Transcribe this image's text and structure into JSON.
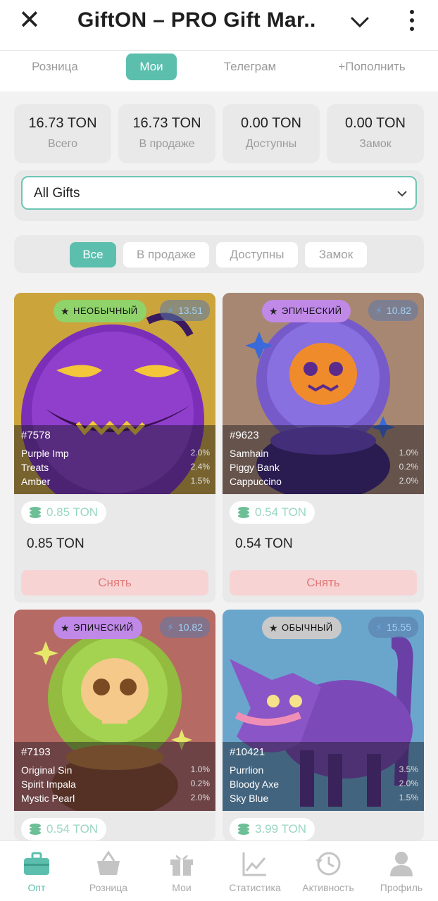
{
  "header": {
    "title": "GiftON – PRO Gift Mar..."
  },
  "tabs": [
    {
      "label": "Розница",
      "active": false
    },
    {
      "label": "Мои",
      "active": true
    },
    {
      "label": "Телеграм",
      "active": false
    },
    {
      "label": "+Пополнить",
      "active": false
    }
  ],
  "stats": [
    {
      "value": "16.73 TON",
      "label": "Всего"
    },
    {
      "value": "16.73 TON",
      "label": "В продаже"
    },
    {
      "value": "0.00 TON",
      "label": "Доступны"
    },
    {
      "value": "0.00 TON",
      "label": "Замок"
    }
  ],
  "select": {
    "value": "All Gifts"
  },
  "filters": [
    {
      "label": "Все",
      "active": true
    },
    {
      "label": "В продаже",
      "active": false
    },
    {
      "label": "Доступны",
      "active": false
    },
    {
      "label": "Замок",
      "active": false
    }
  ],
  "gifts": [
    {
      "rarity": "НЕОБЫЧНЫЙ",
      "rarity_color": "#8fd36a",
      "score": "13.51",
      "number": "#7578",
      "attrs": [
        {
          "name": "Purple Imp",
          "pct": "2.0%"
        },
        {
          "name": "Treats",
          "pct": "2.4%"
        },
        {
          "name": "Amber",
          "pct": "1.5%"
        }
      ],
      "price_badge": "0.85 TON",
      "price": "0.85 TON",
      "action": "Снять",
      "bg": "#caa23a"
    },
    {
      "rarity": "ЭПИЧЕСКИЙ",
      "rarity_color": "#c089e8",
      "score": "10.82",
      "number": "#9623",
      "attrs": [
        {
          "name": "Samhain",
          "pct": "1.0%"
        },
        {
          "name": "Piggy Bank",
          "pct": "0.2%"
        },
        {
          "name": "Cappuccino",
          "pct": "2.0%"
        }
      ],
      "price_badge": "0.54 TON",
      "price": "0.54 TON",
      "action": "Снять",
      "bg": "#a88772"
    },
    {
      "rarity": "ЭПИЧЕСКИЙ",
      "rarity_color": "#c089e8",
      "score": "10.82",
      "number": "#7193",
      "attrs": [
        {
          "name": "Original Sin",
          "pct": "1.0%"
        },
        {
          "name": "Spirit Impala",
          "pct": "0.2%"
        },
        {
          "name": "Mystic Pearl",
          "pct": "2.0%"
        }
      ],
      "price_badge": "0.54 TON",
      "bg": "#b66a64"
    },
    {
      "rarity": "ОБЫЧНЫЙ",
      "rarity_color": "#c9c9c9",
      "score": "15.55",
      "number": "#10421",
      "attrs": [
        {
          "name": "Purrlion",
          "pct": "3.5%"
        },
        {
          "name": "Bloody Axe",
          "pct": "2.0%"
        },
        {
          "name": "Sky Blue",
          "pct": "1.5%"
        }
      ],
      "price_badge": "3.99 TON",
      "bg": "#6aa6cc"
    }
  ],
  "nav": [
    {
      "label": "Опт",
      "icon": "briefcase-icon",
      "active": true
    },
    {
      "label": "Розница",
      "icon": "basket-icon",
      "active": false
    },
    {
      "label": "Мои",
      "icon": "gift-icon",
      "active": false
    },
    {
      "label": "Статистика",
      "icon": "chart-icon",
      "active": false
    },
    {
      "label": "Активность",
      "icon": "history-icon",
      "active": false
    },
    {
      "label": "Профиль",
      "icon": "user-icon",
      "active": false
    }
  ],
  "colors": {
    "accent": "#5cbfae",
    "danger_bg": "#f7d3d3",
    "danger_text": "#e07979"
  }
}
